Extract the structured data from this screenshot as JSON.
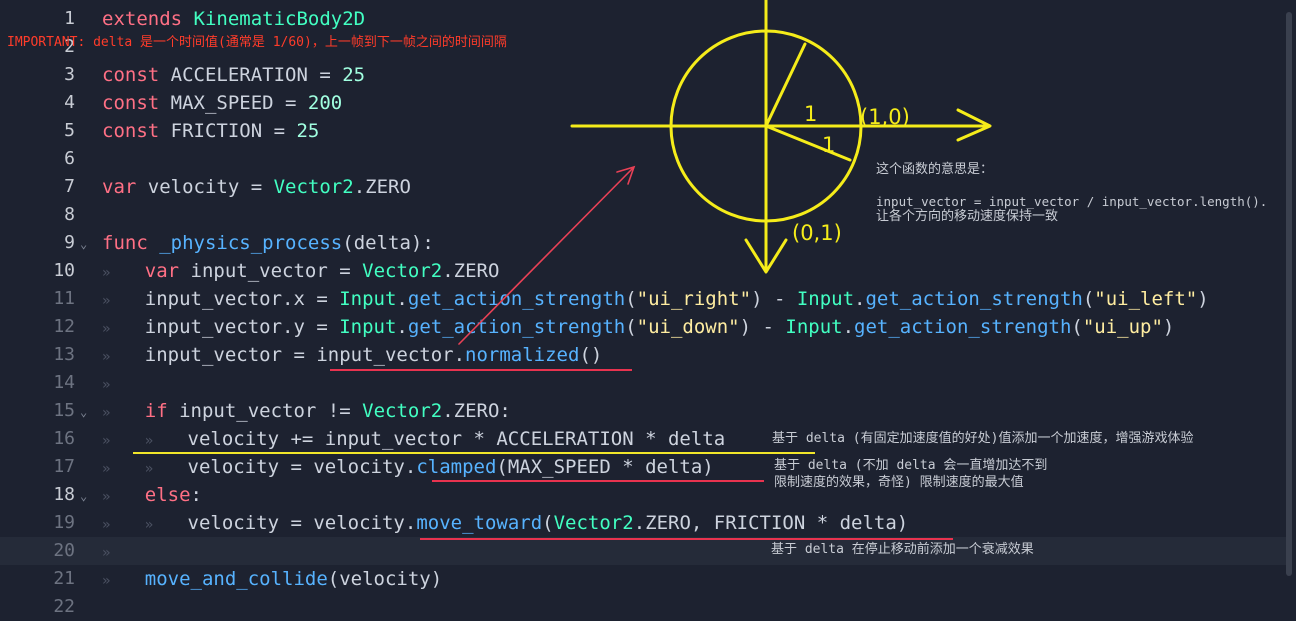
{
  "lines": [
    {
      "n": "1",
      "dim": false,
      "fold": "",
      "segs": [
        [
          "kw",
          "extends"
        ],
        [
          "id",
          " "
        ],
        [
          "ty",
          "KinematicBody2D"
        ]
      ]
    },
    {
      "n": "2",
      "dim": false,
      "fold": "",
      "segs": []
    },
    {
      "n": "3",
      "dim": false,
      "fold": "",
      "segs": [
        [
          "kw",
          "const"
        ],
        [
          "id",
          " ACCELERATION = "
        ],
        [
          "nm",
          "25"
        ]
      ]
    },
    {
      "n": "4",
      "dim": false,
      "fold": "",
      "segs": [
        [
          "kw",
          "const"
        ],
        [
          "id",
          " MAX_SPEED = "
        ],
        [
          "nm",
          "200"
        ]
      ]
    },
    {
      "n": "5",
      "dim": false,
      "fold": "",
      "segs": [
        [
          "kw",
          "const"
        ],
        [
          "id",
          " FRICTION = "
        ],
        [
          "nm",
          "25"
        ]
      ]
    },
    {
      "n": "6",
      "dim": false,
      "fold": "",
      "segs": []
    },
    {
      "n": "7",
      "dim": false,
      "fold": "",
      "segs": [
        [
          "kw",
          "var"
        ],
        [
          "id",
          " velocity = "
        ],
        [
          "ty",
          "Vector2"
        ],
        [
          "id",
          ".ZERO"
        ]
      ]
    },
    {
      "n": "8",
      "dim": false,
      "fold": "",
      "segs": []
    },
    {
      "n": "9",
      "dim": false,
      "fold": "⌄",
      "segs": [
        [
          "kw",
          "func"
        ],
        [
          "id",
          " "
        ],
        [
          "fn",
          "_physics_process"
        ],
        [
          "id",
          "(delta):"
        ]
      ]
    },
    {
      "n": "10",
      "dim": false,
      "fold": "",
      "segs": [
        [
          "tab",
          "»"
        ],
        [
          "id",
          "   "
        ],
        [
          "kw",
          "var"
        ],
        [
          "id",
          " input_vector = "
        ],
        [
          "ty",
          "Vector2"
        ],
        [
          "id",
          ".ZERO"
        ]
      ]
    },
    {
      "n": "11",
      "dim": true,
      "fold": "",
      "segs": [
        [
          "tab",
          "»"
        ],
        [
          "id",
          "   input_vector.x = "
        ],
        [
          "ty",
          "Input"
        ],
        [
          "id",
          "."
        ],
        [
          "fn",
          "get_action_strength"
        ],
        [
          "id",
          "("
        ],
        [
          "st",
          "\"ui_right\""
        ],
        [
          "id",
          ") - "
        ],
        [
          "ty",
          "Input"
        ],
        [
          "id",
          "."
        ],
        [
          "fn",
          "get_action_strength"
        ],
        [
          "id",
          "("
        ],
        [
          "st",
          "\"ui_left\""
        ],
        [
          "id",
          ")"
        ]
      ]
    },
    {
      "n": "12",
      "dim": true,
      "fold": "",
      "segs": [
        [
          "tab",
          "»"
        ],
        [
          "id",
          "   input_vector.y = "
        ],
        [
          "ty",
          "Input"
        ],
        [
          "id",
          "."
        ],
        [
          "fn",
          "get_action_strength"
        ],
        [
          "id",
          "("
        ],
        [
          "st",
          "\"ui_down\""
        ],
        [
          "id",
          ") - "
        ],
        [
          "ty",
          "Input"
        ],
        [
          "id",
          "."
        ],
        [
          "fn",
          "get_action_strength"
        ],
        [
          "id",
          "("
        ],
        [
          "st",
          "\"ui_up\""
        ],
        [
          "id",
          ")"
        ]
      ]
    },
    {
      "n": "13",
      "dim": true,
      "fold": "",
      "segs": [
        [
          "tab",
          "»"
        ],
        [
          "id",
          "   input_vector = input_vector."
        ],
        [
          "fn",
          "normalized"
        ],
        [
          "id",
          "()"
        ]
      ]
    },
    {
      "n": "14",
      "dim": true,
      "fold": "",
      "segs": [
        [
          "tab",
          "»"
        ]
      ]
    },
    {
      "n": "15",
      "dim": true,
      "fold": "⌄",
      "segs": [
        [
          "tab",
          "»"
        ],
        [
          "id",
          "   "
        ],
        [
          "kw",
          "if"
        ],
        [
          "id",
          " input_vector != "
        ],
        [
          "ty",
          "Vector2"
        ],
        [
          "id",
          ".ZERO:"
        ]
      ]
    },
    {
      "n": "16",
      "dim": true,
      "fold": "",
      "segs": [
        [
          "tab",
          "»"
        ],
        [
          "id",
          "   "
        ],
        [
          "tab",
          "»"
        ],
        [
          "id",
          "   velocity += input_vector * ACCELERATION * delta"
        ]
      ]
    },
    {
      "n": "17",
      "dim": true,
      "fold": "",
      "segs": [
        [
          "tab",
          "»"
        ],
        [
          "id",
          "   "
        ],
        [
          "tab",
          "»"
        ],
        [
          "id",
          "   velocity = velocity."
        ],
        [
          "fn",
          "clamped"
        ],
        [
          "id",
          "(MAX_SPEED * delta)"
        ]
      ]
    },
    {
      "n": "18",
      "dim": false,
      "fold": "⌄",
      "segs": [
        [
          "tab",
          "»"
        ],
        [
          "id",
          "   "
        ],
        [
          "kw",
          "else"
        ],
        [
          "id",
          ":"
        ]
      ]
    },
    {
      "n": "19",
      "dim": true,
      "fold": "",
      "segs": [
        [
          "tab",
          "»"
        ],
        [
          "id",
          "   "
        ],
        [
          "tab",
          "»"
        ],
        [
          "id",
          "   velocity = velocity."
        ],
        [
          "fn",
          "move_toward"
        ],
        [
          "id",
          "("
        ],
        [
          "ty",
          "Vector2"
        ],
        [
          "id",
          ".ZERO, FRICTION * delta)"
        ]
      ]
    },
    {
      "n": "20",
      "dim": true,
      "fold": "",
      "segs": [
        [
          "tab",
          "»"
        ]
      ]
    },
    {
      "n": "21",
      "dim": true,
      "fold": "",
      "segs": [
        [
          "tab",
          "»"
        ],
        [
          "id",
          "   "
        ],
        [
          "fn",
          "move_and_collide"
        ],
        [
          "id",
          "(velocity)"
        ]
      ]
    },
    {
      "n": "22",
      "dim": true,
      "fold": "",
      "segs": []
    }
  ],
  "annotations": {
    "important": "IMPORTANT: delta 是一个时间值(通常是 1/60)，上一帧到下一帧之间的时间间隔",
    "func_meaning": "这个函数的意思是：",
    "formula": "input_vector = input_vector / input_vector.length().",
    "formula_note": "让各个方向的移动速度保持一致",
    "accel_note": "基于 delta (有固定加速度值的好处)值添加一个加速度，增强游戏体验",
    "clamp_note_1": "基于 delta (不加 delta 会一直增加达不到",
    "clamp_note_2": "限制速度的效果，奇怪) 限制速度的最大值",
    "friction_note": "基于 delta 在停止移动前添加一个衰减效果"
  },
  "sketch_labels": {
    "radius_a": "1",
    "radius_b": "1",
    "point_x": "(1,0)",
    "point_y": "(0,1)"
  },
  "colors": {
    "background": "#1d2230",
    "keyword": "#ff7085",
    "type": "#42ffc2",
    "function": "#57b3ff",
    "string": "#ffeda1",
    "annotation_red": "#e8334f",
    "annotation_yellow": "#f1e62a"
  }
}
